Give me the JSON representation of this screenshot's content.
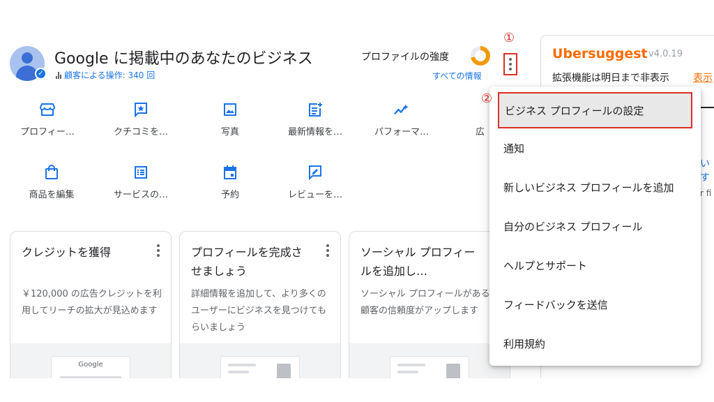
{
  "header": {
    "title": "Google に掲載中のあなたのビジネス",
    "stats": "顧客による操作: 340 回",
    "strength_label": "プロファイルの強度",
    "all_info": "すべての情報",
    "marker_1": "①",
    "marker_2": "②"
  },
  "actions": [
    {
      "label": "プロフィー…",
      "icon": "storefront-icon"
    },
    {
      "label": "クチコミを…",
      "icon": "review-star-icon"
    },
    {
      "label": "写真",
      "icon": "photo-icon"
    },
    {
      "label": "最新情報を…",
      "icon": "post-add-icon"
    },
    {
      "label": "パフォーマ…",
      "icon": "sparkline-icon"
    },
    {
      "label": "広",
      "icon": "ads-icon"
    },
    {
      "label": "商品を編集",
      "icon": "shopping-bag-icon"
    },
    {
      "label": "サービスの…",
      "icon": "list-icon"
    },
    {
      "label": "予約",
      "icon": "calendar-icon"
    },
    {
      "label": "レビューを…",
      "icon": "review-edit-icon"
    }
  ],
  "cards": [
    {
      "title": "クレジットを獲得",
      "body": "￥120,000 の広告クレジットを利用してリーチの拡大が見込めます",
      "image_text": "Google"
    },
    {
      "title": "プロフィールを完成させましょう",
      "body": "詳細情報を追加して、より多くのユーザーにビジネスを見つけてもらいましょう",
      "image_text": ""
    },
    {
      "title": "ソーシャル プロフィールを追加し…",
      "body": "ソーシャル プロフィールがあると顧客の信頼度がアップします",
      "image_text": ""
    }
  ],
  "ubersuggest": {
    "name": "Ubersuggest",
    "version": "v4.0.19",
    "hide_text": "拡張機能は明日まで非表示",
    "show_link": "表示",
    "fragment_1": "いす",
    "fragment_2": "r fi"
  },
  "menu": {
    "items": [
      "ビジネス プロフィールの設定",
      "通知",
      "新しいビジネス プロフィールを追加",
      "自分のビジネス プロフィール",
      "ヘルプとサポート",
      "フィードバックを送信",
      "利用規約"
    ]
  },
  "colors": {
    "accent": "#1a73e8",
    "highlight": "#d93025",
    "uber_orange": "#ff6a00",
    "strength_ring": "#f29900"
  }
}
